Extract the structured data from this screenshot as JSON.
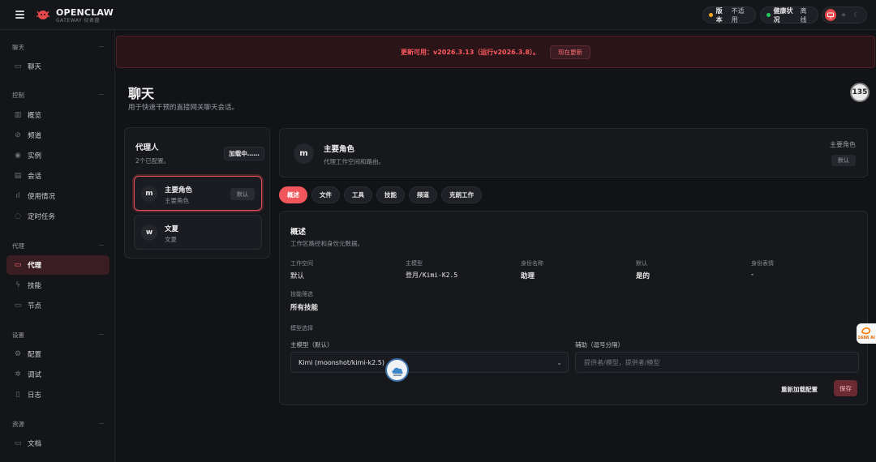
{
  "brand": {
    "name": "OPENCLAW",
    "subtitle": "GATEWAY 仪表盘"
  },
  "status": {
    "version_label": "版本",
    "version_value": "不适用",
    "version_dot_color": "#f5a524",
    "health_label": "健康状况",
    "health_value": "离线",
    "health_dot_color": "#22c55e"
  },
  "theme_icons": [
    "monitor-icon",
    "sun-icon",
    "moon-icon"
  ],
  "sidebar": {
    "sections": [
      {
        "title": "聊天",
        "items": [
          {
            "label": "聊天",
            "icon": "chat-bubble-icon"
          }
        ]
      },
      {
        "title": "控制",
        "items": [
          {
            "label": "概览",
            "icon": "bar-chart-icon"
          },
          {
            "label": "频道",
            "icon": "link-icon"
          },
          {
            "label": "实例",
            "icon": "radio-icon"
          },
          {
            "label": "会话",
            "icon": "document-icon"
          },
          {
            "label": "使用情况",
            "icon": "stats-icon"
          },
          {
            "label": "定时任务",
            "icon": "loader-icon"
          }
        ]
      },
      {
        "title": "代理",
        "items": [
          {
            "label": "代理",
            "icon": "folder-icon",
            "active": true
          },
          {
            "label": "技能",
            "icon": "lightning-icon"
          },
          {
            "label": "节点",
            "icon": "monitor-icon"
          }
        ]
      },
      {
        "title": "设置",
        "items": [
          {
            "label": "配置",
            "icon": "gear-icon"
          },
          {
            "label": "调试",
            "icon": "bug-icon"
          },
          {
            "label": "日志",
            "icon": "log-icon"
          }
        ]
      },
      {
        "title": "资源",
        "items": [
          {
            "label": "文档",
            "icon": "book-icon"
          }
        ]
      }
    ]
  },
  "banner": {
    "text": "更新可用：v2026.3.13（运行v2026.3.8）。",
    "button": "现在更新"
  },
  "page": {
    "title": "聊天",
    "subtitle": "用于快速干预的直接网关聊天会话。",
    "counter": "135"
  },
  "agents": {
    "title": "代理人",
    "count_text": "2个已配置。",
    "loading_button": "加载中……",
    "list": [
      {
        "avatar": "m",
        "name": "主要角色",
        "role": "主要角色",
        "badge": "默认",
        "selected": true
      },
      {
        "avatar": "w",
        "name": "文夏",
        "role": "文夏",
        "badge": "",
        "selected": false
      }
    ]
  },
  "agent_header": {
    "avatar": "m",
    "name": "主要角色",
    "desc": "代理工作空间和路由。",
    "right_title": "主要角色",
    "right_badge": "默认"
  },
  "tabs": [
    "概述",
    "文件",
    "工具",
    "技能",
    "频道",
    "克朗工作"
  ],
  "overview": {
    "title": "概述",
    "subtitle": "工作区路径和身份元数据。",
    "fields": [
      {
        "label": "工作空间",
        "value": "默认"
      },
      {
        "label": "主模型",
        "value": "登月/Kimi-K2.5"
      },
      {
        "label": "身份名称",
        "value": "助理"
      },
      {
        "label": "默认",
        "value": "是的"
      },
      {
        "label": "身份表情",
        "value": "-"
      }
    ],
    "skills_filter_label": "技能筛选",
    "skills_filter_value": "所有技能",
    "model_select_label": "模型选择",
    "primary_model_label": "主模型（默认）",
    "primary_model_value": "Kimi (moonshot/kimi-k2.5)",
    "fallback_label": "辅助（逗号分隔）",
    "fallback_placeholder": "提供者/模型，提供者/模型",
    "reload_button": "重新加载配置",
    "save_button": "保存"
  },
  "float_widget": {
    "label": "1688 AI"
  }
}
